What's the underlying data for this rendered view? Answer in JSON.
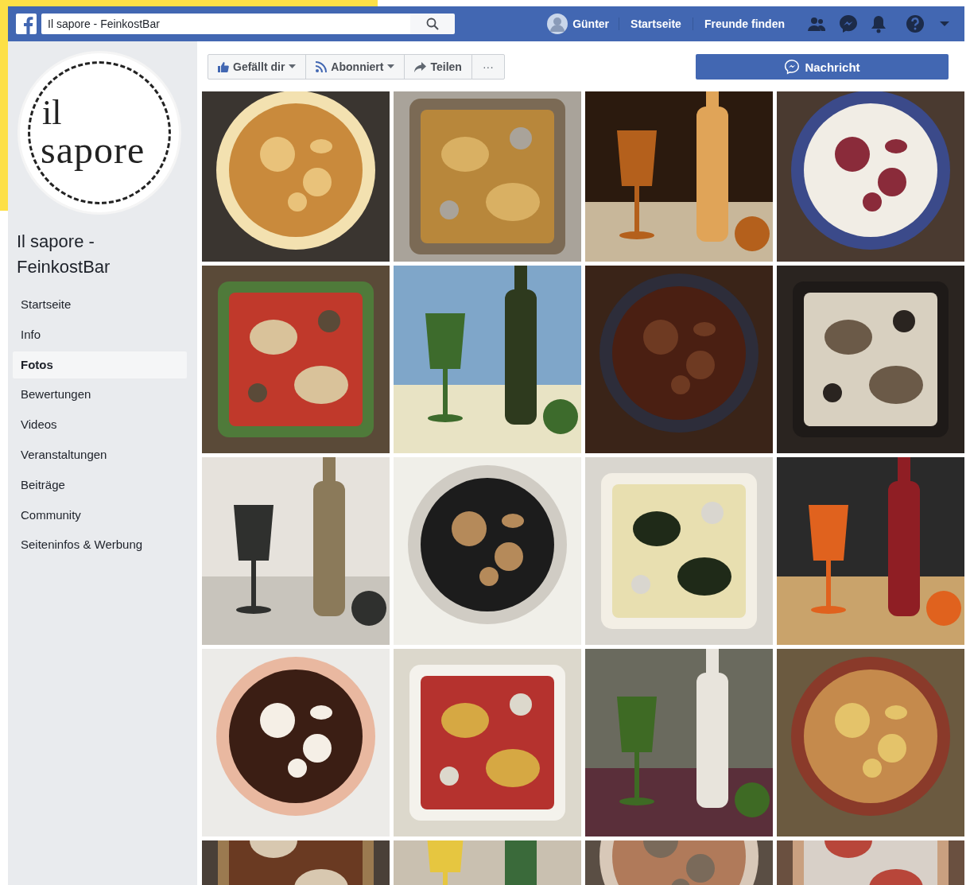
{
  "topbar": {
    "search_value": "Il sapore - FeinkostBar",
    "user": "Günter",
    "links": [
      "Startseite",
      "Freunde finden"
    ]
  },
  "sidebar": {
    "logo_lines": [
      "il",
      "sapore"
    ],
    "page_name": "Il sapore - FeinkostBar",
    "items": [
      {
        "label": "Startseite",
        "selected": false
      },
      {
        "label": "Info",
        "selected": false
      },
      {
        "label": "Fotos",
        "selected": true
      },
      {
        "label": "Bewertungen",
        "selected": false
      },
      {
        "label": "Videos",
        "selected": false
      },
      {
        "label": "Veranstaltungen",
        "selected": false
      },
      {
        "label": "Beiträge",
        "selected": false
      },
      {
        "label": "Community",
        "selected": false
      },
      {
        "label": "Seiteninfos & Werbung",
        "selected": false
      }
    ]
  },
  "actions": [
    {
      "kind": "like",
      "label": "Gefällt dir"
    },
    {
      "kind": "follow",
      "label": "Abonniert"
    },
    {
      "kind": "share",
      "label": "Teilen"
    },
    {
      "kind": "more",
      "label": "···"
    }
  ],
  "message_button": "Nachricht"
}
